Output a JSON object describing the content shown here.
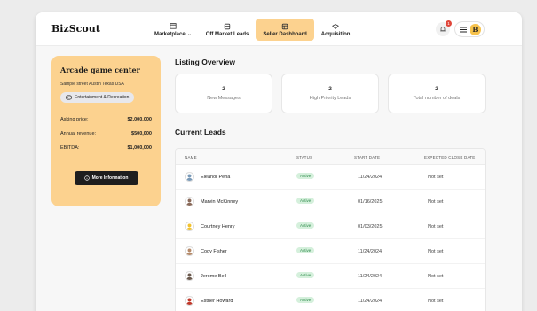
{
  "app": {
    "logo": "BizScout"
  },
  "nav": [
    {
      "label": "Marketplace",
      "icon": "storefront-icon",
      "dropdown": true,
      "active": false
    },
    {
      "label": "Off Market Leads",
      "icon": "building-icon",
      "dropdown": false,
      "active": false
    },
    {
      "label": "Seller Dashboard",
      "icon": "dashboard-icon",
      "dropdown": false,
      "active": true
    },
    {
      "label": "Acquisition",
      "icon": "handshake-icon",
      "dropdown": false,
      "active": false
    }
  ],
  "notifications": {
    "count": "1"
  },
  "user": {
    "initial": "B"
  },
  "listing": {
    "title": "Arcade game center",
    "address": "Sample street Austin Texas USA",
    "category": "Entertainment & Recreation",
    "financials": [
      {
        "label": "Asking price:",
        "value": "$2,000,000"
      },
      {
        "label": "Annual revenue:",
        "value": "$500,000"
      },
      {
        "label": "EBITDA:",
        "value": "$1,000,000"
      }
    ],
    "more_button": "More Information"
  },
  "overview": {
    "title": "Listing Overview",
    "stats": [
      {
        "value": "2",
        "label": "New Messages"
      },
      {
        "value": "2",
        "label": "High Priority Leads"
      },
      {
        "value": "2",
        "label": "Total number of deals"
      }
    ]
  },
  "leads": {
    "title": "Current Leads",
    "columns": [
      "NAME",
      "STATUS",
      "START DATE",
      "EXPECTED CLOSE DATE"
    ],
    "rows": [
      {
        "name": "Eleanor Pena",
        "status": "Active",
        "start": "11/24/2024",
        "close": "Not set",
        "avatar_color": "#7a9ab8"
      },
      {
        "name": "Marvin McKinney",
        "status": "Active",
        "start": "01/16/2025",
        "close": "Not set",
        "avatar_color": "#8a6a5a"
      },
      {
        "name": "Courtney Henry",
        "status": "Active",
        "start": "01/03/2025",
        "close": "Not set",
        "avatar_color": "#f2c230"
      },
      {
        "name": "Cody Fisher",
        "status": "Active",
        "start": "11/24/2024",
        "close": "Not set",
        "avatar_color": "#b58a6a"
      },
      {
        "name": "Jerome Bell",
        "status": "Active",
        "start": "11/24/2024",
        "close": "Not set",
        "avatar_color": "#6b5a4e"
      },
      {
        "name": "Esther Howard",
        "status": "Active",
        "start": "11/24/2024",
        "close": "Not set",
        "avatar_color": "#c0392b"
      }
    ]
  },
  "colors": {
    "accent": "#fcd28f",
    "status_bg": "#d5f0dc",
    "status_text": "#2e8b4b"
  }
}
